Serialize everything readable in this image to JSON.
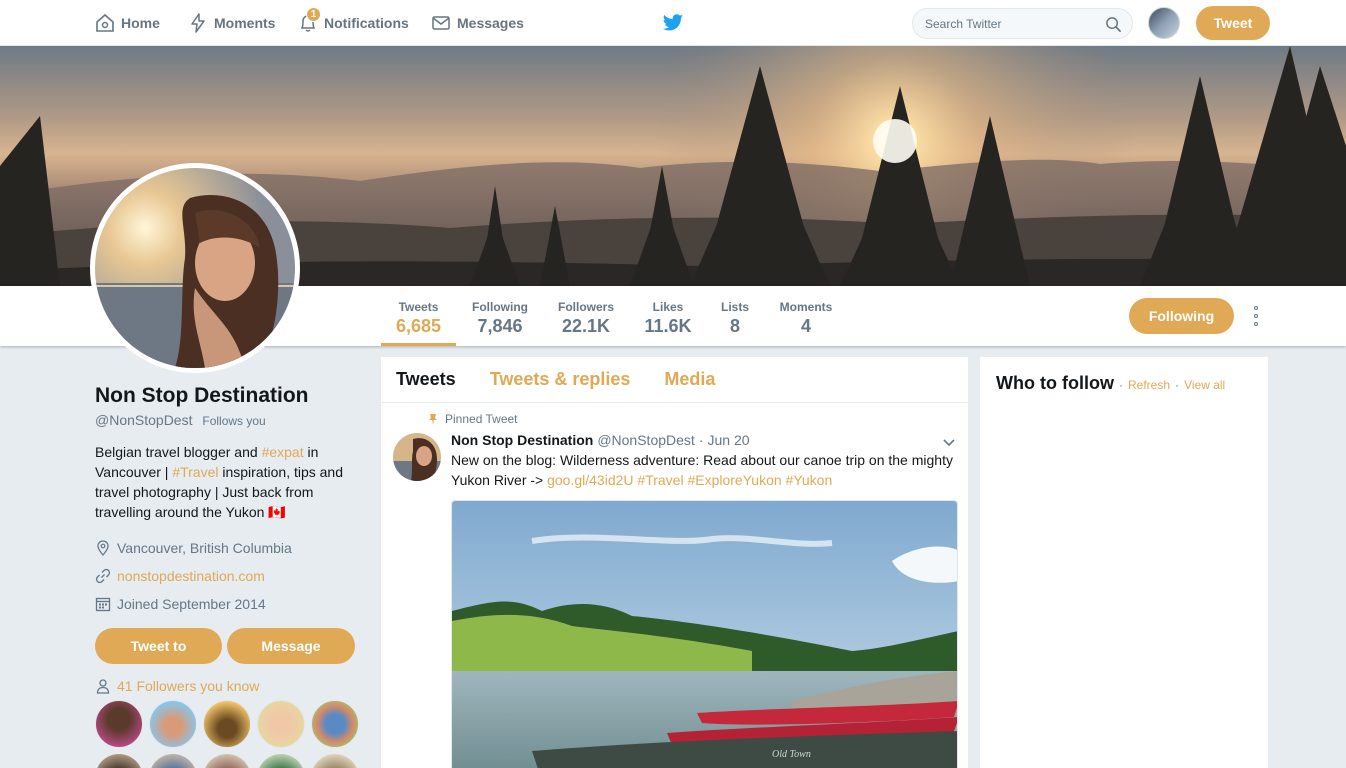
{
  "topnav": {
    "items": [
      {
        "label": "Home",
        "icon": "home-icon"
      },
      {
        "label": "Moments",
        "icon": "lightning-icon"
      },
      {
        "label": "Notifications",
        "icon": "bell-icon",
        "badge": "1"
      },
      {
        "label": "Messages",
        "icon": "envelope-icon"
      }
    ],
    "search_placeholder": "Search Twitter",
    "tweet_label": "Tweet"
  },
  "profile_nav": {
    "stats": [
      {
        "label": "Tweets",
        "value": "6,685"
      },
      {
        "label": "Following",
        "value": "7,846"
      },
      {
        "label": "Followers",
        "value": "22.1K"
      },
      {
        "label": "Likes",
        "value": "11.6K"
      },
      {
        "label": "Lists",
        "value": "8"
      },
      {
        "label": "Moments",
        "value": "4"
      }
    ],
    "following_label": "Following"
  },
  "profile": {
    "name": "Non Stop Destination",
    "handle": "@NonStopDest",
    "follows_you": "Follows you",
    "bio_1": "Belgian travel blogger and ",
    "bio_tag1": "#expat",
    "bio_2": " in Vancouver | ",
    "bio_tag2": "#Travel",
    "bio_3": " inspiration, tips and travel photography | Just back from travelling around the Yukon ",
    "bio_flag": "🇨🇦",
    "location": "Vancouver, British Columbia",
    "website": "nonstopdestination.com",
    "joined": "Joined September 2014",
    "tweet_to_label": "Tweet to",
    "message_label": "Message",
    "followers_you_know": "41 Followers you know"
  },
  "timeline": {
    "tabs": [
      "Tweets",
      "Tweets & replies",
      "Media"
    ],
    "tweet": {
      "pinned_label": "Pinned Tweet",
      "name": "Non Stop Destination",
      "handle": "@NonStopDest",
      "sep": "·",
      "date": "Jun 20",
      "text_1": "New on the blog: Wilderness adventure: Read about our canoe trip on the mighty Yukon River -> ",
      "link": "goo.gl/43id2U",
      "tags": "#Travel #ExploreYukon #Yukon",
      "media_text": "Old Town"
    }
  },
  "who_to_follow": {
    "title": "Who to follow",
    "sep": "·",
    "refresh": "Refresh",
    "view_all": "View all"
  },
  "colors": {
    "accent": "#e0a955",
    "muted": "#657786",
    "background": "#e6ecf0",
    "twitter_blue": "#1da1f2"
  }
}
